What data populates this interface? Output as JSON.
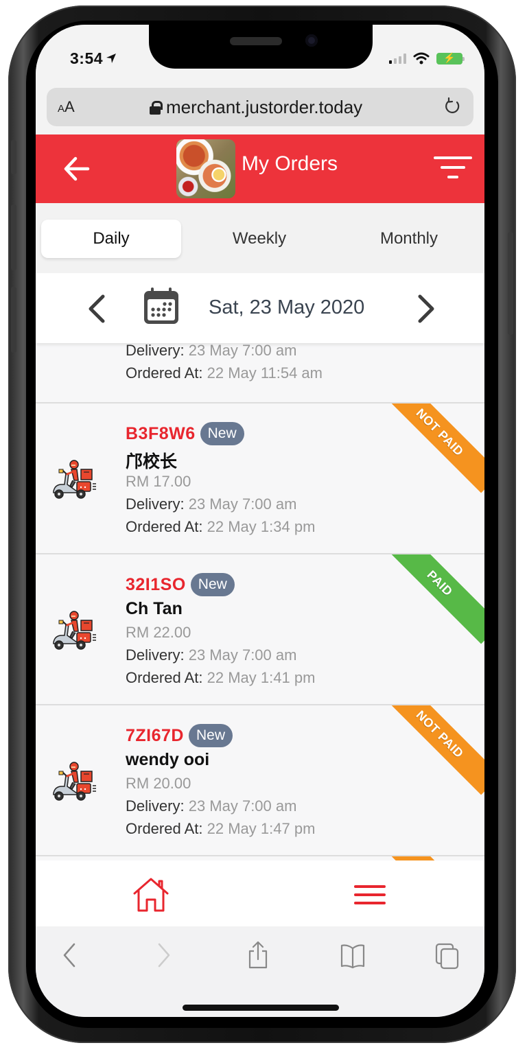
{
  "status_bar": {
    "time": "3:54",
    "location_glyph": "➤",
    "signal_icon": "cellular-signal-icon",
    "wifi_icon": "wifi-icon",
    "battery_icon": "battery-charging-icon",
    "battery_glyph": "⚡"
  },
  "browser": {
    "text_size_button": {
      "small": "A",
      "large": "A"
    },
    "url": "merchant.justorder.today",
    "lock_icon": "lock-icon",
    "reload_icon": "reload-icon"
  },
  "header": {
    "title": "My Orders",
    "back_icon": "arrow-left-icon",
    "filter_icon": "filter-icon",
    "brand_color": "#ed333b"
  },
  "tabs": [
    {
      "label": "Daily",
      "active": true
    },
    {
      "label": "Weekly",
      "active": false
    },
    {
      "label": "Monthly",
      "active": false
    }
  ],
  "date_selector": {
    "date": "Sat, 23 May 2020",
    "prev_icon": "chevron-left-icon",
    "next_icon": "chevron-right-icon",
    "calendar_icon": "calendar-icon"
  },
  "partial_order": {
    "delivery_label": "Delivery:",
    "delivery_value": "23 May 7:00 am",
    "ordered_label": "Ordered At:",
    "ordered_value": "22 May 11:54 am"
  },
  "orders": [
    {
      "code": "B3F8W6",
      "badge": "New",
      "customer": "邝校长",
      "amount": "RM 17.00",
      "delivery_label": "Delivery:",
      "delivery_value": "23 May 7:00 am",
      "ordered_label": "Ordered At:",
      "ordered_value": "22 May 1:34 pm",
      "payment_status": "NOT PAID",
      "payment_color": "#f5931f"
    },
    {
      "code": "32I1SO",
      "badge": "New",
      "customer": "Ch Tan",
      "amount": "RM 22.00",
      "delivery_label": "Delivery:",
      "delivery_value": "23 May 7:00 am",
      "ordered_label": "Ordered At:",
      "ordered_value": "22 May 1:41 pm",
      "payment_status": "PAID",
      "payment_color": "#57b947"
    },
    {
      "code": "7ZI67D",
      "badge": "New",
      "customer": "wendy ooi",
      "amount": "RM 20.00",
      "delivery_label": "Delivery:",
      "delivery_value": "23 May 7:00 am",
      "ordered_label": "Ordered At:",
      "ordered_value": "22 May 1:47 pm",
      "payment_status": "NOT PAID",
      "payment_color": "#f5931f"
    }
  ],
  "app_nav": {
    "home_icon": "home-icon",
    "menu_icon": "hamburger-menu-icon"
  },
  "safari_toolbar": {
    "back_icon": "chevron-left-icon",
    "forward_icon": "chevron-right-icon",
    "share_icon": "share-icon",
    "bookmarks_icon": "book-icon",
    "tabs_icon": "tabs-icon"
  }
}
